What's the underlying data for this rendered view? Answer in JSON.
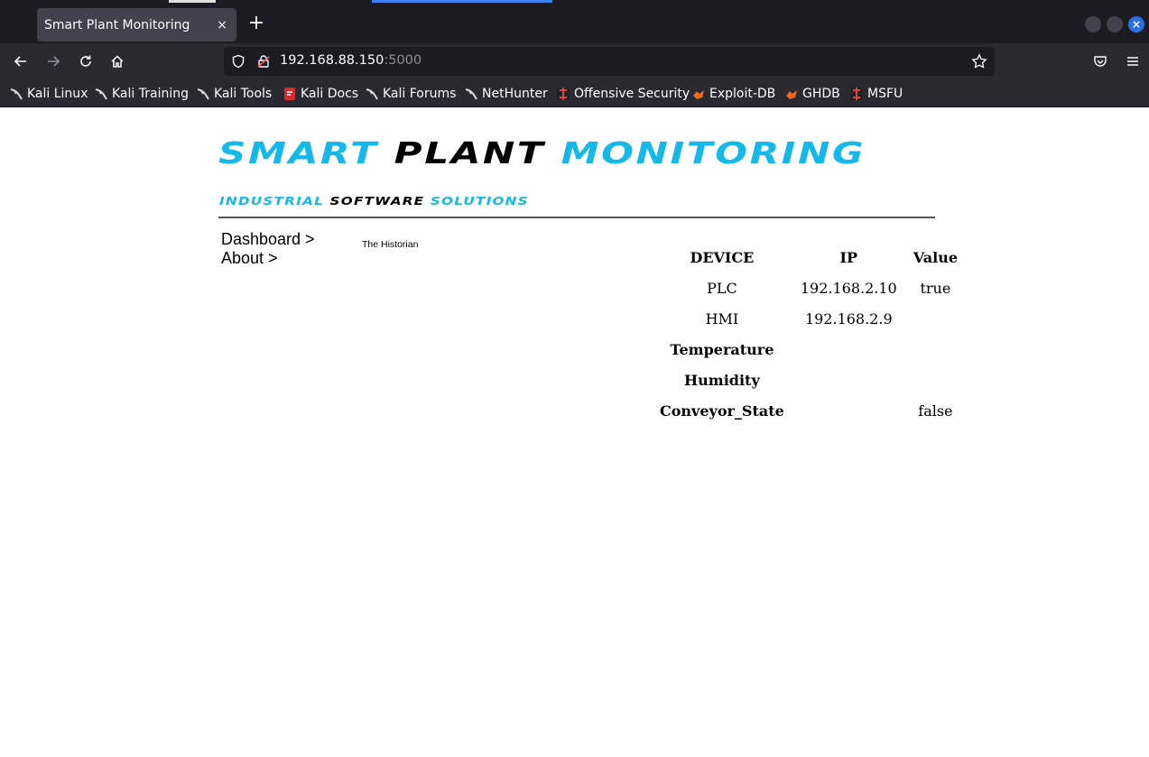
{
  "browser": {
    "tab_title": "Smart Plant Monitoring",
    "tab_close": "×",
    "new_tab": "+",
    "url_host": "192.168.88.150",
    "url_port": ":5000",
    "window_close": "×"
  },
  "bookmarks": [
    {
      "label": "Kali Linux",
      "icon": "kali-dragon-icon"
    },
    {
      "label": "Kali Training",
      "icon": "kali-dragon-icon"
    },
    {
      "label": "Kali Tools",
      "icon": "kali-dragon-icon"
    },
    {
      "label": "Kali Docs",
      "icon": "kali-docs-icon"
    },
    {
      "label": "Kali Forums",
      "icon": "kali-dragon-icon"
    },
    {
      "label": "NetHunter",
      "icon": "kali-dragon-icon"
    },
    {
      "label": "Offensive Security",
      "icon": "offsec-icon"
    },
    {
      "label": "Exploit-DB",
      "icon": "exploit-db-icon"
    },
    {
      "label": "GHDB",
      "icon": "exploit-db-icon"
    },
    {
      "label": "MSFU",
      "icon": "offsec-icon"
    }
  ],
  "page": {
    "logo": {
      "word1": "SMART",
      "word2": "PLANT",
      "word3": "MONITORING"
    },
    "tagline": {
      "word1": "INDUSTRIAL",
      "word2": "SOFTWARE",
      "word3": "SOLUTIONS"
    },
    "menu": {
      "dashboard": "Dashboard >",
      "about": "About >"
    },
    "historian_label": "The Historian",
    "table": {
      "headers": [
        "DEVICE",
        "IP",
        "Value"
      ],
      "rows": [
        {
          "device": "PLC",
          "ip": "192.168.2.10",
          "value": "true"
        },
        {
          "device": "HMI",
          "ip": "192.168.2.9",
          "value": ""
        },
        {
          "device": "Temperature",
          "ip": "",
          "value": ""
        },
        {
          "device": "Humidity",
          "ip": "",
          "value": ""
        },
        {
          "device": "Conveyor_State",
          "ip": "",
          "value": "false"
        }
      ]
    }
  },
  "colors": {
    "brand_blue": "#14b8e9",
    "chrome_dark": "#1c1b22",
    "chrome_mid": "#2b2a33",
    "tab_active": "#42414d",
    "window_close": "#2b6fe0"
  }
}
